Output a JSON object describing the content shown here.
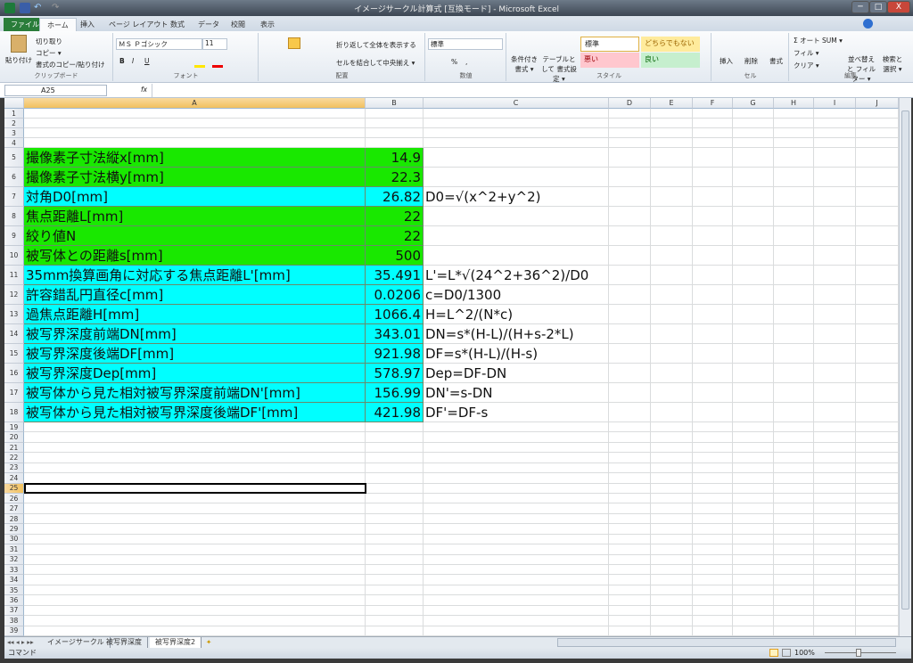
{
  "window": {
    "title": "イメージサークル計算式  [互換モード]  -  Microsoft Excel",
    "min": "─",
    "max": "□",
    "close": "X"
  },
  "ribbon": {
    "tabs": [
      "ファイル",
      "ホーム",
      "挿入",
      "ページ レイアウト",
      "数式",
      "データ",
      "校閲",
      "表示"
    ],
    "active_tab": "ホーム",
    "clipboard": {
      "paste": "貼り付け",
      "cut": "切り取り",
      "copy": "コピー ▾",
      "format_painter": "書式のコピー/貼り付け",
      "label": "クリップボード"
    },
    "font": {
      "name": "ＭＳ Ｐゴシック",
      "size": "11",
      "bold": "B",
      "italic": "I",
      "underline": "U",
      "label": "フォント"
    },
    "alignment": {
      "wrap": "折り返して全体を表示する",
      "merge": "セルを結合して中央揃え ▾",
      "label": "配置"
    },
    "number": {
      "format": "標準",
      "percent": "%",
      "comma": ",",
      "label": "数値"
    },
    "styles": {
      "conditional": "条件付き 書式 ▾",
      "table": "テーブルとして 書式設定 ▾",
      "normal": "標準",
      "neutral": "どちらでもない",
      "bad": "悪い",
      "good": "良い",
      "label": "スタイル"
    },
    "cells": {
      "insert": "挿入",
      "delete": "削除",
      "format": "書式",
      "label": "セル"
    },
    "editing": {
      "autosum": "Σ オート SUM ▾",
      "fill": "フィル ▾",
      "clear": "クリア ▾",
      "sort": "並べ替えと フィルター ▾",
      "find": "検索と 選択 ▾",
      "label": "編集"
    }
  },
  "formula_bar": {
    "name_box": "A25",
    "fx": "fx",
    "value": ""
  },
  "columns": [
    "A",
    "B",
    "C",
    "D",
    "E",
    "F",
    "G",
    "H",
    "I",
    "J"
  ],
  "colors": {
    "green": "#19e800",
    "cyan": "#00ffff",
    "selection": "#000000"
  },
  "sheet": {
    "rows": [
      {
        "row": 5,
        "a": "撮像素子寸法縦x[mm]",
        "b": "14.9",
        "c": "",
        "fill": "green"
      },
      {
        "row": 6,
        "a": "撮像素子寸法横y[mm]",
        "b": "22.3",
        "c": "",
        "fill": "green"
      },
      {
        "row": 7,
        "a": "対角D0[mm]",
        "b": "26.82",
        "c": "D0=√(x^2+y^2)",
        "fill": "cyan"
      },
      {
        "row": 8,
        "a": "焦点距離L[mm]",
        "b": "22",
        "c": "",
        "fill": "green"
      },
      {
        "row": 9,
        "a": "絞り値N",
        "b": "22",
        "c": "",
        "fill": "green"
      },
      {
        "row": 10,
        "a": "被写体との距離s[mm]",
        "b": "500",
        "c": "",
        "fill": "green"
      },
      {
        "row": 11,
        "a": "35mm換算画角に対応する焦点距離L'[mm]",
        "b": "35.491",
        "c": "L'=L*√(24^2+36^2)/D0",
        "fill": "cyan"
      },
      {
        "row": 12,
        "a": "許容錯乱円直径c[mm]",
        "b": "0.0206",
        "c": "c=D0/1300",
        "fill": "cyan"
      },
      {
        "row": 13,
        "a": "過焦点距離H[mm]",
        "b": "1066.4",
        "c": "H=L^2/(N*c)",
        "fill": "cyan"
      },
      {
        "row": 14,
        "a": "被写界深度前端DN[mm]",
        "b": "343.01",
        "c": "DN=s*(H-L)/(H+s-2*L)",
        "fill": "cyan"
      },
      {
        "row": 15,
        "a": "被写界深度後端DF[mm]",
        "b": "921.98",
        "c": "DF=s*(H-L)/(H-s)",
        "fill": "cyan"
      },
      {
        "row": 16,
        "a": "被写界深度Dep[mm]",
        "b": "578.97",
        "c": "Dep=DF-DN",
        "fill": "cyan"
      },
      {
        "row": 17,
        "a": "被写体から見た相対被写界深度前端DN'[mm]",
        "b": "156.99",
        "c": "DN'=s-DN",
        "fill": "cyan"
      },
      {
        "row": 18,
        "a": "被写体から見た相対被写界深度後端DF'[mm]",
        "b": "421.98",
        "c": "DF'=DF-s",
        "fill": "cyan"
      }
    ],
    "selected_cell": "A25"
  },
  "sheet_tabs": [
    "イメージサークル",
    "被写界深度",
    "被写界深度2"
  ],
  "active_sheet": "被写界深度2",
  "status": {
    "mode": "コマンド",
    "zoom": "100%"
  }
}
